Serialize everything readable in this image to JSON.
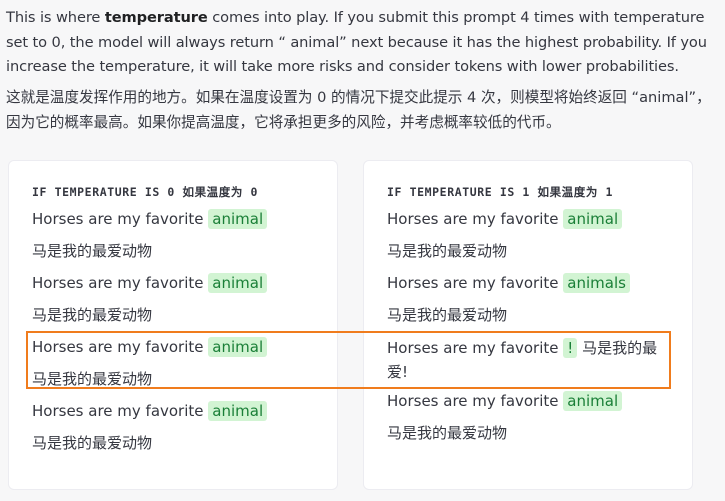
{
  "intro": {
    "part1": "This is where ",
    "bold": "temperature",
    "part2": " comes into play. If you submit this prompt 4 times with temperature set to 0, the model will always return “ animal” next because it has the highest probability. If you increase the temperature, it will take more risks and consider tokens with lower probabilities.",
    "zh": "这就是温度发挥作用的地方。如果在温度设置为 0 的情况下提交此提示 4 次，则模型将始终返回 “animal”，因为它的概率最高。如果你提高温度，它将承担更多的风险，并考虑概率较低的代币。"
  },
  "left": {
    "title": "IF TEMPERATURE IS 0 如果温度为 0",
    "rows": [
      {
        "prompt": "Horses are my favorite",
        "token": "animal",
        "zh": "马是我的最爱动物"
      },
      {
        "prompt": "Horses are my favorite",
        "token": "animal",
        "zh": "马是我的最爱动物"
      },
      {
        "prompt": "Horses are my favorite",
        "token": "animal",
        "zh": "马是我的最爱动物"
      },
      {
        "prompt": "Horses are my favorite",
        "token": "animal",
        "zh": "马是我的最爱动物"
      }
    ]
  },
  "right": {
    "title": "IF TEMPERATURE IS 1 如果温度为 1",
    "rows": [
      {
        "prompt": "Horses are my favorite",
        "token": "animal",
        "zh": "马是我的最爱动物"
      },
      {
        "prompt": "Horses are my favorite",
        "token": "animals",
        "zh": "马是我的最爱动物"
      },
      {
        "prompt": "Horses are my favorite",
        "token": "!",
        "zh": "马是我的最爱!"
      },
      {
        "prompt": "Horses are my favorite",
        "token": "animal",
        "zh": "马是我的最爱动物"
      }
    ]
  },
  "colors": {
    "token_bg": "#d2f4d3",
    "token_text": "#1a7f37",
    "highlight_border": "#f07c1d"
  }
}
